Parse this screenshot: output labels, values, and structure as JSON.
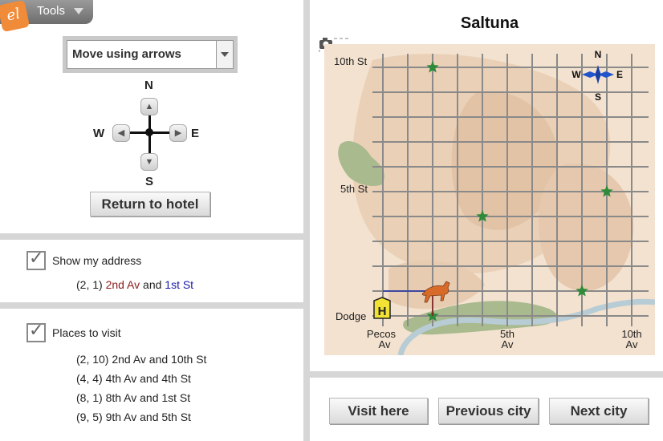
{
  "toolbar": {
    "logo_text": "el",
    "tools_label": "Tools"
  },
  "controls": {
    "mode_selected": "Move using arrows",
    "compass_labels": {
      "n": "N",
      "s": "S",
      "e": "E",
      "w": "W"
    },
    "return_button": "Return to hotel"
  },
  "address": {
    "checkbox_label": "Show my address",
    "coords": "(2, 1)",
    "avenue": "2nd Av",
    "joiner": "and",
    "street": "1st St",
    "avenue_color": "#8b1a1a",
    "street_color": "#1a1aa8"
  },
  "places": {
    "checkbox_label": "Places to visit",
    "items": [
      "(2, 10) 2nd Av and 10th St",
      "(4, 4) 4th Av and 4th St",
      "(8, 1) 8th Av and 1st St",
      "(9, 5) 9th Av and 5th St"
    ]
  },
  "map": {
    "title": "Saltuna",
    "street_labels": {
      "tenth": "10th St",
      "fifth": "5th St",
      "dodge": "Dodge"
    },
    "avenue_labels": {
      "pecos": [
        "Pecos",
        "Av"
      ],
      "fifth": [
        "5th",
        "Av"
      ],
      "tenth": [
        "10th",
        "Av"
      ]
    },
    "compass": {
      "n": "N",
      "s": "S",
      "e": "E",
      "w": "W"
    },
    "hotel_marker": "H",
    "player_position": [
      2,
      1
    ],
    "places_to_visit": [
      [
        2,
        10
      ],
      [
        4,
        4
      ],
      [
        8,
        1
      ],
      [
        9,
        5
      ]
    ],
    "star_color": "#2e8b3a",
    "grid_color": "#8a8a8a"
  },
  "nav": {
    "visit_button": "Visit here",
    "prev_button": "Previous city",
    "next_button": "Next city"
  }
}
